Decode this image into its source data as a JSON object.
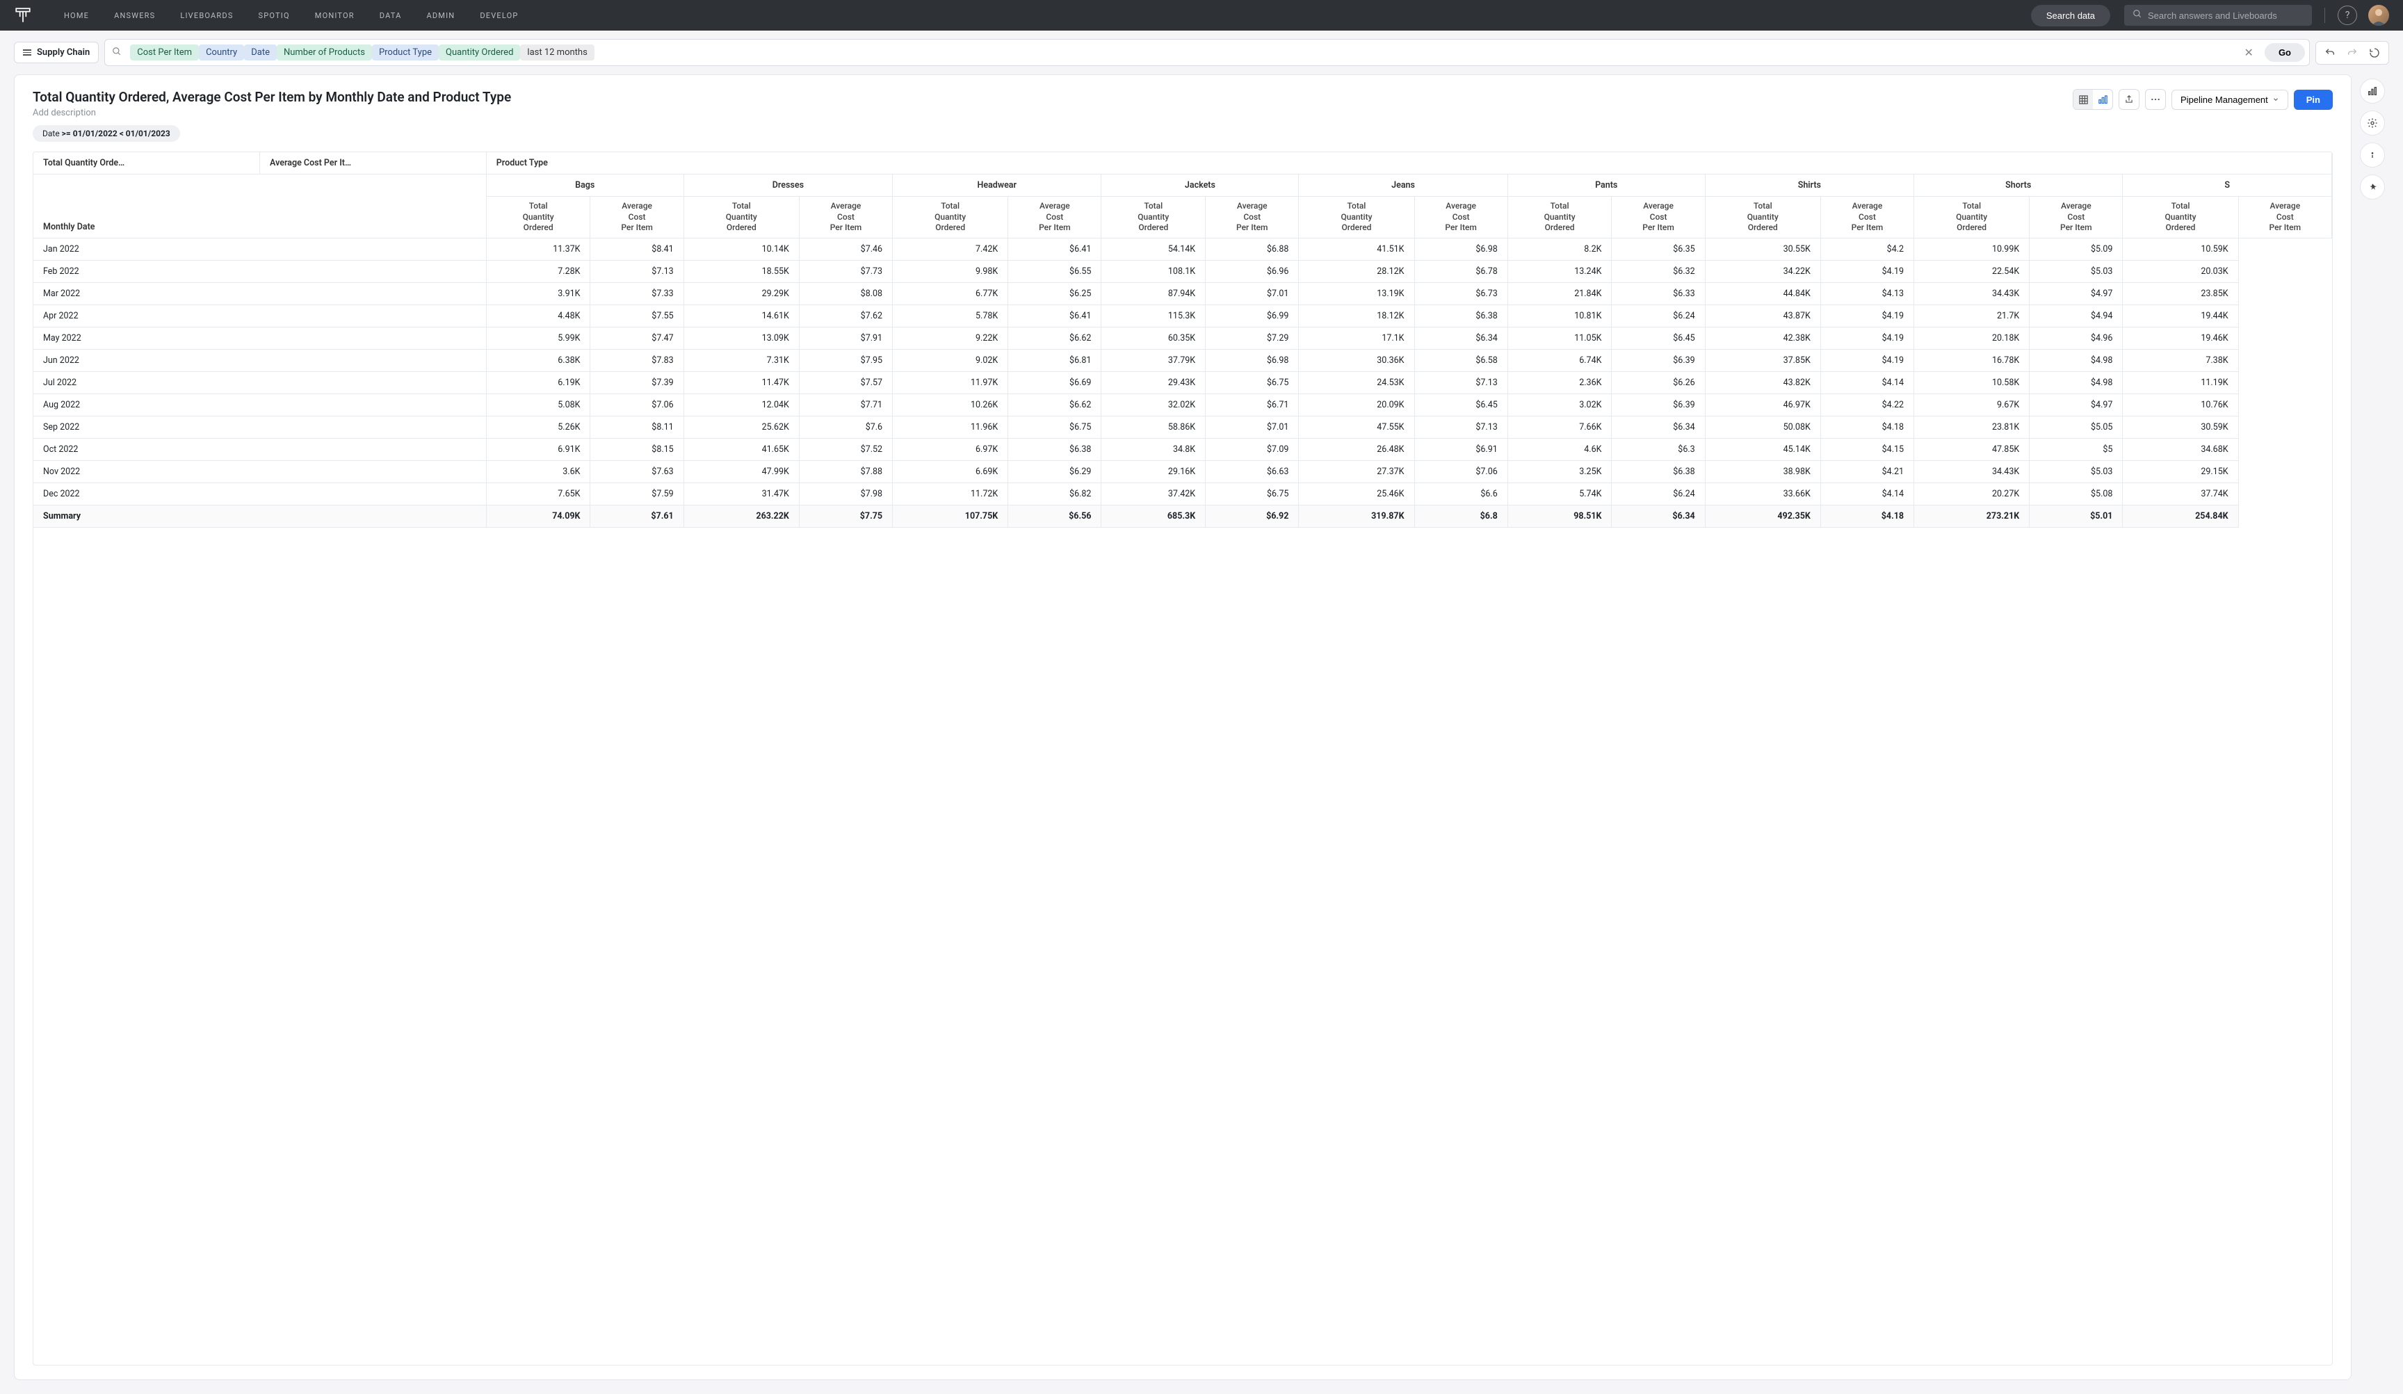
{
  "nav": [
    "HOME",
    "ANSWERS",
    "LIVEBOARDS",
    "SPOTIQ",
    "MONITOR",
    "DATA",
    "ADMIN",
    "DEVELOP"
  ],
  "search_data_btn": "Search data",
  "global_search_placeholder": "Search answers and Liveboards",
  "data_source": "Supply Chain",
  "query_chips": [
    {
      "text": "Cost Per Item",
      "cls": "green"
    },
    {
      "text": "Country",
      "cls": "blue"
    },
    {
      "text": "Date",
      "cls": "blue"
    },
    {
      "text": "Number of Products",
      "cls": "green"
    },
    {
      "text": "Product Type",
      "cls": "blue"
    },
    {
      "text": "Quantity Ordered",
      "cls": "green"
    },
    {
      "text": "last 12 months",
      "cls": "gray"
    }
  ],
  "go_btn": "Go",
  "title": "Total Quantity Ordered, Average Cost Per Item by Monthly Date and Product Type",
  "add_description": "Add description",
  "pipeline_label": "Pipeline Management",
  "pin_label": "Pin",
  "filter_prefix": "Date ",
  "filter_bold": ">= 01/01/2022 < 01/01/2023",
  "col_headers": {
    "tqo": "Total Quantity Orde…",
    "acpi": "Average Cost Per It…",
    "pt": "Product Type",
    "month": "Monthly Date",
    "tqo_full": "Total Quantity Ordered",
    "acpi_full": "Average Cost Per Item"
  },
  "product_types": [
    "Bags",
    "Dresses",
    "Headwear",
    "Jackets",
    "Jeans",
    "Pants",
    "Shirts",
    "Shorts",
    "S"
  ],
  "rows": [
    {
      "m": "Jan 2022",
      "v": [
        "11.37K",
        "$8.41",
        "10.14K",
        "$7.46",
        "7.42K",
        "$6.41",
        "54.14K",
        "$6.88",
        "41.51K",
        "$6.98",
        "8.2K",
        "$6.35",
        "30.55K",
        "$4.2",
        "10.99K",
        "$5.09",
        "10.59K"
      ]
    },
    {
      "m": "Feb 2022",
      "v": [
        "7.28K",
        "$7.13",
        "18.55K",
        "$7.73",
        "9.98K",
        "$6.55",
        "108.1K",
        "$6.96",
        "28.12K",
        "$6.78",
        "13.24K",
        "$6.32",
        "34.22K",
        "$4.19",
        "22.54K",
        "$5.03",
        "20.03K"
      ]
    },
    {
      "m": "Mar 2022",
      "v": [
        "3.91K",
        "$7.33",
        "29.29K",
        "$8.08",
        "6.77K",
        "$6.25",
        "87.94K",
        "$7.01",
        "13.19K",
        "$6.73",
        "21.84K",
        "$6.33",
        "44.84K",
        "$4.13",
        "34.43K",
        "$4.97",
        "23.85K"
      ]
    },
    {
      "m": "Apr 2022",
      "v": [
        "4.48K",
        "$7.55",
        "14.61K",
        "$7.62",
        "5.78K",
        "$6.41",
        "115.3K",
        "$6.99",
        "18.12K",
        "$6.38",
        "10.81K",
        "$6.24",
        "43.87K",
        "$4.19",
        "21.7K",
        "$4.94",
        "19.44K"
      ]
    },
    {
      "m": "May 2022",
      "v": [
        "5.99K",
        "$7.47",
        "13.09K",
        "$7.91",
        "9.22K",
        "$6.62",
        "60.35K",
        "$7.29",
        "17.1K",
        "$6.34",
        "11.05K",
        "$6.45",
        "42.38K",
        "$4.19",
        "20.18K",
        "$4.96",
        "19.46K"
      ]
    },
    {
      "m": "Jun 2022",
      "v": [
        "6.38K",
        "$7.83",
        "7.31K",
        "$7.95",
        "9.02K",
        "$6.81",
        "37.79K",
        "$6.98",
        "30.36K",
        "$6.58",
        "6.74K",
        "$6.39",
        "37.85K",
        "$4.19",
        "16.78K",
        "$4.98",
        "7.38K"
      ]
    },
    {
      "m": "Jul 2022",
      "v": [
        "6.19K",
        "$7.39",
        "11.47K",
        "$7.57",
        "11.97K",
        "$6.69",
        "29.43K",
        "$6.75",
        "24.53K",
        "$7.13",
        "2.36K",
        "$6.26",
        "43.82K",
        "$4.14",
        "10.58K",
        "$4.98",
        "11.19K"
      ]
    },
    {
      "m": "Aug 2022",
      "v": [
        "5.08K",
        "$7.06",
        "12.04K",
        "$7.71",
        "10.26K",
        "$6.62",
        "32.02K",
        "$6.71",
        "20.09K",
        "$6.45",
        "3.02K",
        "$6.39",
        "46.97K",
        "$4.22",
        "9.67K",
        "$4.97",
        "10.76K"
      ]
    },
    {
      "m": "Sep 2022",
      "v": [
        "5.26K",
        "$8.11",
        "25.62K",
        "$7.6",
        "11.96K",
        "$6.75",
        "58.86K",
        "$7.01",
        "47.55K",
        "$7.13",
        "7.66K",
        "$6.34",
        "50.08K",
        "$4.18",
        "23.81K",
        "$5.05",
        "30.59K"
      ]
    },
    {
      "m": "Oct 2022",
      "v": [
        "6.91K",
        "$8.15",
        "41.65K",
        "$7.52",
        "6.97K",
        "$6.38",
        "34.8K",
        "$7.09",
        "26.48K",
        "$6.91",
        "4.6K",
        "$6.3",
        "45.14K",
        "$4.15",
        "47.85K",
        "$5",
        "34.68K"
      ]
    },
    {
      "m": "Nov 2022",
      "v": [
        "3.6K",
        "$7.63",
        "47.99K",
        "$7.88",
        "6.69K",
        "$6.29",
        "29.16K",
        "$6.63",
        "27.37K",
        "$7.06",
        "3.25K",
        "$6.38",
        "38.98K",
        "$4.21",
        "34.43K",
        "$5.03",
        "29.15K"
      ]
    },
    {
      "m": "Dec 2022",
      "v": [
        "7.65K",
        "$7.59",
        "31.47K",
        "$7.98",
        "11.72K",
        "$6.82",
        "37.42K",
        "$6.75",
        "25.46K",
        "$6.6",
        "5.74K",
        "$6.24",
        "33.66K",
        "$4.14",
        "20.27K",
        "$5.08",
        "37.74K"
      ]
    }
  ],
  "summary": {
    "label": "Summary",
    "v": [
      "74.09K",
      "$7.61",
      "263.22K",
      "$7.75",
      "107.75K",
      "$6.56",
      "685.3K",
      "$6.92",
      "319.87K",
      "$6.8",
      "98.51K",
      "$6.34",
      "492.35K",
      "$4.18",
      "273.21K",
      "$5.01",
      "254.84K"
    ]
  }
}
